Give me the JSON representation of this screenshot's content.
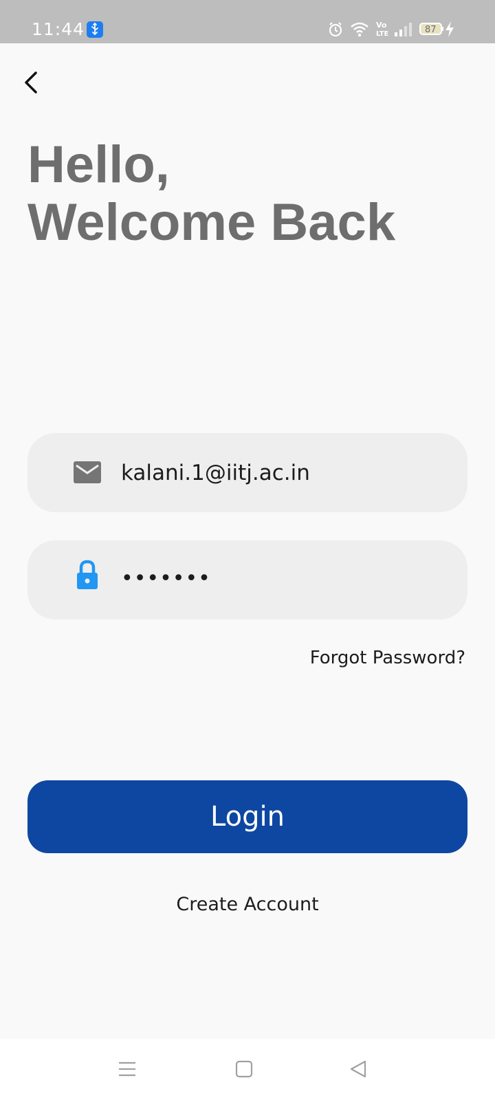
{
  "status_bar": {
    "time": "11:44",
    "battery_level": "87",
    "icons": [
      "usb-icon",
      "alarm-icon",
      "wifi-icon",
      "volte-icon",
      "signal-icon",
      "battery-icon",
      "charging-icon"
    ]
  },
  "header": {
    "back_icon": "back-arrow-icon",
    "greeting_line1": "Hello,",
    "greeting_line2": "Welcome Back"
  },
  "form": {
    "email": {
      "icon": "mail-icon",
      "value": "kalani.1@iitj.ac.in"
    },
    "password": {
      "icon": "lock-icon",
      "value": "•••••••"
    },
    "forgot_label": "Forgot Password?"
  },
  "actions": {
    "login_label": "Login",
    "create_account_label": "Create Account"
  },
  "colors": {
    "primary": "#0e47a1",
    "lock_icon": "#2196f3",
    "heading": "#6e6e6e",
    "field_bg": "#eeeeee"
  },
  "nav_bar": {
    "buttons": [
      "menu-icon",
      "home-icon",
      "back-icon"
    ]
  }
}
